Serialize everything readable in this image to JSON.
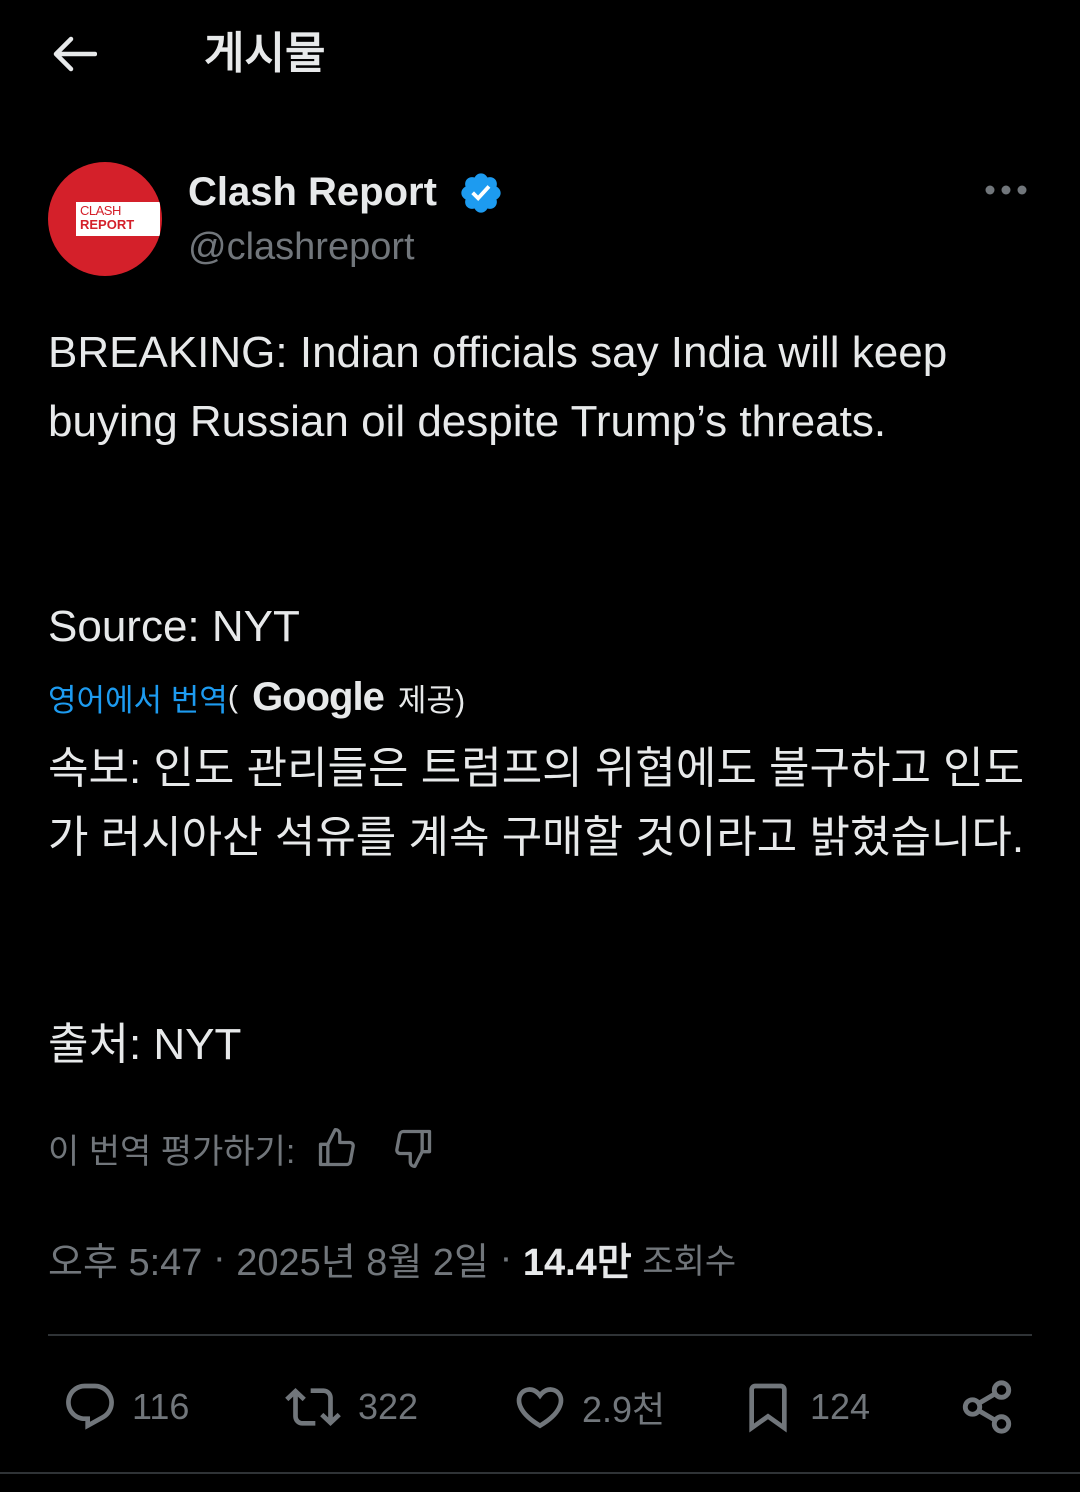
{
  "header": {
    "title": "게시물",
    "back_icon": "arrow-left-icon"
  },
  "author": {
    "display_name": "Clash Report",
    "handle": "@clashreport",
    "verified": true,
    "avatar_text_line1": "CLASH",
    "avatar_text_line2": "REPORT",
    "avatar_color": "#d4202a"
  },
  "tweet": {
    "text": "BREAKING: Indian officials say India will keep buying Russian oil despite Trump’s threats.",
    "source": "Source: NYT"
  },
  "translation": {
    "link_label": "영어에서 번역",
    "open_paren": "(",
    "provider": "Google",
    "provided_label": "제공)",
    "text": "속보: 인도 관리들은 트럼프의 위협에도 불구하고 인도가 러시아산 석유를 계속 구매할 것이라고 밝혔습니다.",
    "source": "출처: NYT",
    "rate_label": "이 번역 평가하기:"
  },
  "meta": {
    "time": "오후 5:47",
    "separator": " · ",
    "date": "2025년 8월 2일",
    "views_count": "14.4만",
    "views_label": "조회수"
  },
  "actions": {
    "replies": "116",
    "reposts": "322",
    "likes": "2.9천",
    "bookmarks": "124"
  },
  "colors": {
    "background": "#000000",
    "text": "#e7e9ea",
    "secondary": "#71767b",
    "link": "#1d9bf0",
    "verified": "#1d9bf0",
    "divider": "#2f3336"
  }
}
